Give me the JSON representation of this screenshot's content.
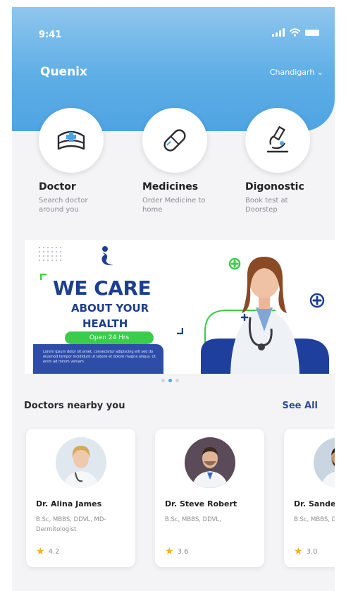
{
  "status_bar": {
    "time": "9:41"
  },
  "header": {
    "brand": "Quenix",
    "city": "Chandigarh ⌄"
  },
  "services": [
    {
      "title": "Doctor",
      "sub": "Search doctor around you",
      "icon": "nurse-cap-icon"
    },
    {
      "title": "Medicines",
      "sub": "Order Medicine to home",
      "icon": "pill-capsule-icon"
    },
    {
      "title": "Digonostic",
      "sub": "Book test at Doorstep",
      "icon": "microscope-icon"
    }
  ],
  "banner": {
    "line1": "WE CARE",
    "line2": "ABOUT YOUR",
    "line3": "HEALTH",
    "pill": "Open 24 Hrs",
    "fine_print": "Lorem ipsum dolor sit amet, consectetur adipiscing elit sed do eiusmod tempor incididunt ut labore et dolore magna aliqua. Ut enim ad minim veniam"
  },
  "carousel": {
    "pages": 3,
    "active": 1
  },
  "doctors_section": {
    "title": "Doctors nearby you",
    "see_all": "See All"
  },
  "doctors": [
    {
      "name": "Dr. Alina James",
      "qualification": "B.Sc, MBBS, DDVL, MD- Dermitologist",
      "rating": "4.2"
    },
    {
      "name": "Dr. Steve Robert",
      "qualification": "B.Sc, MBBS, DDVL,",
      "rating": "3.6"
    },
    {
      "name": "Dr. Sandeep",
      "qualification": "B.Sc, MBBS, D Dermitologi",
      "rating": "3.0"
    }
  ],
  "colors": {
    "header_blue": "#5eaee6",
    "brand_navy": "#1d3f8f",
    "accent_green": "#3ccc4b",
    "star_yellow": "#f2b01e"
  }
}
